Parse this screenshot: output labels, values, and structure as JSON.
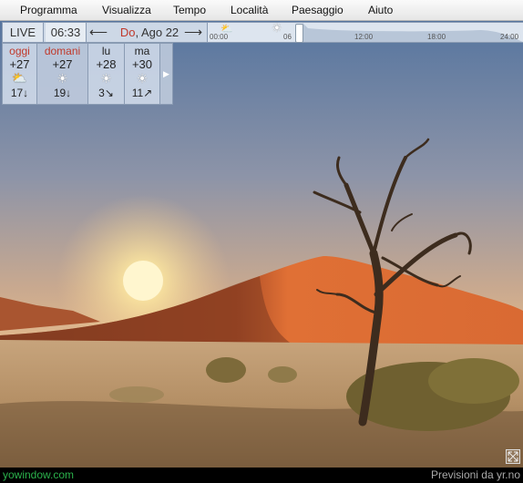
{
  "menu": [
    "Programma",
    "Visualizza",
    "Tempo",
    "Località",
    "Paesaggio",
    "Aiuto"
  ],
  "toolbar": {
    "live_label": "LIVE",
    "time": "06:33",
    "prev_arrow": "⟵",
    "next_arrow": "⟶",
    "date_dow": "Do",
    "date_rest": ", Ago 22"
  },
  "timeline": {
    "labels": [
      "00:00",
      "06",
      "12:00",
      "18:00",
      "24:00"
    ],
    "position_fraction": 0.27
  },
  "forecast": [
    {
      "name": "oggi",
      "high": "+27",
      "low": "17",
      "wind_arrow": "↓",
      "icon": "partly-cloudy-icon",
      "name_color": "red"
    },
    {
      "name": "domani",
      "high": "+27",
      "low": "19",
      "wind_arrow": "↓",
      "icon": "sun-icon",
      "name_color": "red"
    },
    {
      "name": "lu",
      "high": "+28",
      "low": "3",
      "wind_arrow": "↘",
      "icon": "sun-icon",
      "name_color": "normal"
    },
    {
      "name": "ma",
      "high": "+30",
      "low": "11",
      "wind_arrow": "↗",
      "icon": "sun-icon",
      "name_color": "normal"
    }
  ],
  "forecast_more": "▶",
  "footer": {
    "left": "yowindow.com",
    "right": "Previsioni da yr.no"
  },
  "colors": {
    "sky_top": "#5a78a0",
    "dune": "#d2622f",
    "ground": "#b89672"
  }
}
